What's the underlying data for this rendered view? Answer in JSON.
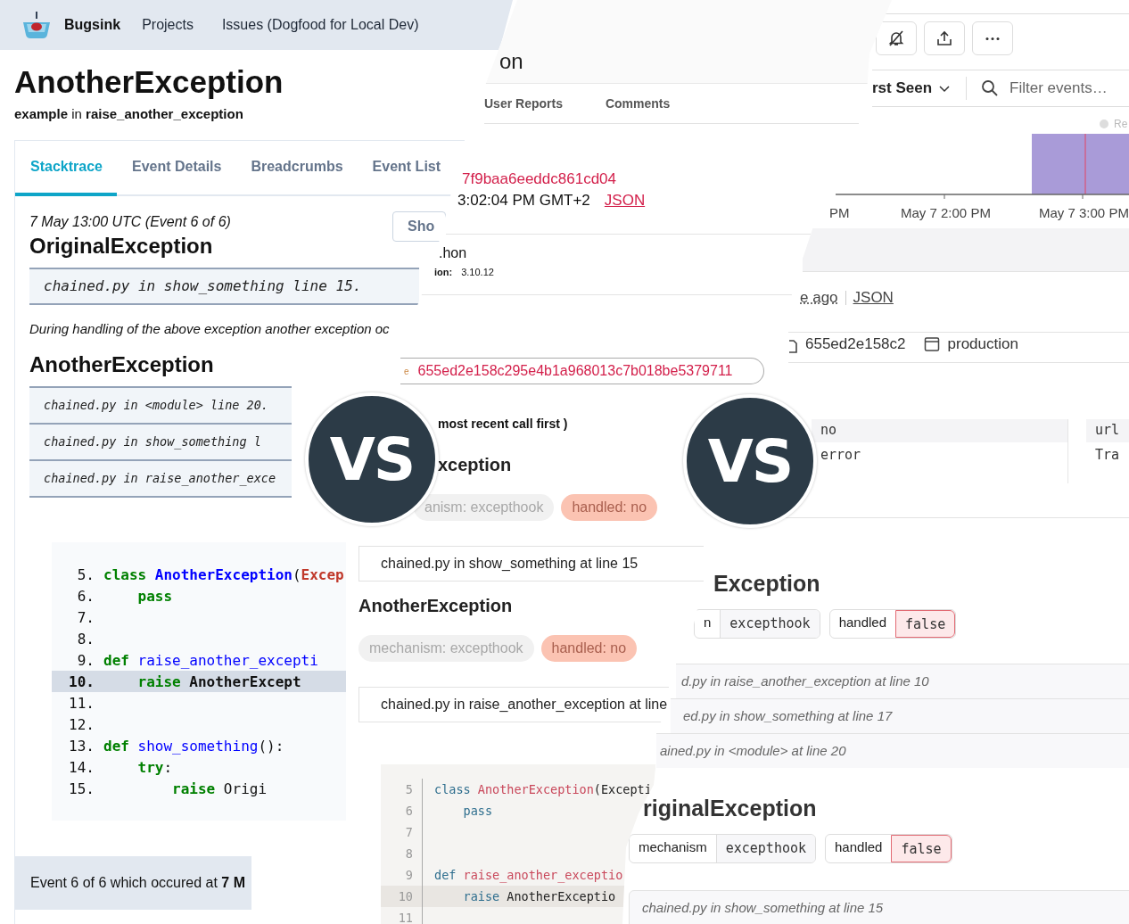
{
  "bugsink_panel": {
    "nav": {
      "brand": "Bugsink",
      "links": [
        "Projects",
        "Issues (Dogfood for Local Dev)"
      ]
    },
    "title": "AnotherException",
    "subtitle": "**example** in **raise_another_exception**",
    "tabs": [
      {
        "label": "Stacktrace",
        "selected": true
      },
      {
        "label": "Event Details",
        "selected": false
      },
      {
        "label": "Breadcrumbs",
        "selected": false
      },
      {
        "label": "Event List",
        "selected": false
      }
    ],
    "show_button": "Sho",
    "event_heading": "7 May 13:00 UTC (Event 6 of 6)",
    "chain_message": "During handling of the above exception another exception oc",
    "exceptions": [
      {
        "name": "OriginalException",
        "frames": [
          "chained.py in show_something line 15."
        ]
      },
      {
        "name": "AnotherException",
        "frames": [
          "chained.py in <module> line 20.",
          "chained.py in show_something l",
          "chained.py in raise_another_exce"
        ]
      }
    ],
    "code_lines": [
      {
        "number": "5.",
        "current": false,
        "tokens": [
          {
            "kind": "keyword",
            "text": "class "
          },
          {
            "kind": "class",
            "text": "AnotherException"
          },
          {
            "kind": "plain",
            "text": "("
          },
          {
            "kind": "builtin",
            "text": "Excep"
          }
        ]
      },
      {
        "number": "6.",
        "current": false,
        "tokens": [
          {
            "kind": "keyword",
            "text": "    pass"
          }
        ]
      },
      {
        "number": "7.",
        "current": false
      },
      {
        "number": "8.",
        "current": false
      },
      {
        "number": "9.",
        "current": false,
        "tokens": [
          {
            "kind": "keyword",
            "text": "def "
          },
          {
            "kind": "function",
            "text": "raise_another_excepti"
          }
        ]
      },
      {
        "number": "10.",
        "current": true,
        "tokens": [
          {
            "kind": "keyword",
            "text": "    raise"
          },
          {
            "kind": "plain",
            "text": " AnotherExcept"
          }
        ]
      },
      {
        "number": "11.",
        "current": false
      },
      {
        "number": "12.",
        "current": false
      },
      {
        "number": "13.",
        "current": false,
        "tokens": [
          {
            "kind": "keyword",
            "text": "def "
          },
          {
            "kind": "function",
            "text": "show_something"
          },
          {
            "kind": "plain",
            "text": "():"
          }
        ]
      },
      {
        "number": "14.",
        "current": false,
        "tokens": [
          {
            "kind": "keyword",
            "text": "    try"
          },
          {
            "kind": "plain",
            "text": ":"
          }
        ]
      },
      {
        "number": "15.",
        "current": false,
        "tokens": [
          {
            "kind": "keyword",
            "text": "        raise"
          },
          {
            "kind": "plain",
            "text": " Origi"
          }
        ]
      }
    ],
    "footer": "Event 6 of 6 which occured at **7 M**"
  },
  "sentry_panel": {
    "title_fragment": "on",
    "tabs": [
      {
        "label": "User Reports",
        "selected": false
      },
      {
        "label": "Comments",
        "selected": false
      }
    ],
    "event_id": "7f9baa6eeddc861cd04",
    "timestamp": "3:02:04 PM GMT+2",
    "json_link": "JSON",
    "runtime_name": ".hon",
    "runtime_version": {
      "label": "ion:",
      "value": "3.10.12"
    },
    "hash": {
      "prefix": "e",
      "value": "655ed2e158c295e4b1a968013c7b018be5379711"
    },
    "order_note": "most recent call first )",
    "exceptions": [
      {
        "name": "xception",
        "tags": [
          {
            "kind": "mechanism",
            "text": "anism: excepthook"
          },
          {
            "kind": "handled",
            "text": "handled: no"
          }
        ],
        "frame": "chained.py in show_something at line 15"
      },
      {
        "name": "AnotherException",
        "tags": [
          {
            "kind": "mechanism",
            "text": "mechanism: excepthook"
          },
          {
            "kind": "handled",
            "text": "handled: no"
          }
        ],
        "frame": "chained.py in raise_another_exception at line"
      }
    ],
    "code_lines": [
      {
        "number": "5",
        "current": false,
        "tokens": [
          {
            "kind": "keyword",
            "text": "class "
          },
          {
            "kind": "class",
            "text": "AnotherException"
          },
          {
            "kind": "plain",
            "text": "(Excepti"
          }
        ]
      },
      {
        "number": "6",
        "current": false,
        "tokens": [
          {
            "kind": "keyword",
            "text": "    pass"
          }
        ]
      },
      {
        "number": "7",
        "current": false
      },
      {
        "number": "8",
        "current": false
      },
      {
        "number": "9",
        "current": false,
        "tokens": [
          {
            "kind": "keyword",
            "text": "def "
          },
          {
            "kind": "function",
            "text": "raise_another_exceptio"
          }
        ]
      },
      {
        "number": "10",
        "current": true,
        "tokens": [
          {
            "kind": "keyword",
            "text": "    raise"
          },
          {
            "kind": "plain",
            "text": " AnotherExceptio"
          }
        ]
      },
      {
        "number": "11",
        "current": false
      }
    ]
  },
  "glitchtip_panel": {
    "sort": "rst Seen",
    "search": {
      "placeholder": "Filter events…"
    },
    "chart": {
      "legend": "Re",
      "x_labels": [
        "PM",
        "May 7 2:00 PM",
        "May 7 3:00 PM"
      ]
    },
    "event_meta": {
      "age": "e ago",
      "json_link": "JSON"
    },
    "badges": [
      {
        "kind": "commit",
        "text": "655ed2e158c2"
      },
      {
        "kind": "environment",
        "text": "production"
      }
    ],
    "tag_columns": [
      [
        "no",
        "error"
      ],
      [
        "url",
        "Tra"
      ]
    ],
    "exceptions": [
      {
        "name": "Exception",
        "pairs": [
          {
            "label": "n",
            "value": "excepthook",
            "flagged": false
          },
          {
            "label": "handled",
            "value": "false",
            "flagged": true
          }
        ],
        "frames": [
          "d.py in raise_another_exception at line 10",
          "ed.py in show_something at line 17",
          "ained.py in <module> at line 20"
        ]
      },
      {
        "name": "riginalException",
        "pairs": [
          {
            "label": "mechanism",
            "value": "excepthook",
            "flagged": false
          },
          {
            "label": "handled",
            "value": "false",
            "flagged": true
          }
        ],
        "frames": [
          "chained.py in show_something at line 15"
        ]
      }
    ]
  },
  "versus_badges": [
    "VS",
    "VS"
  ]
}
